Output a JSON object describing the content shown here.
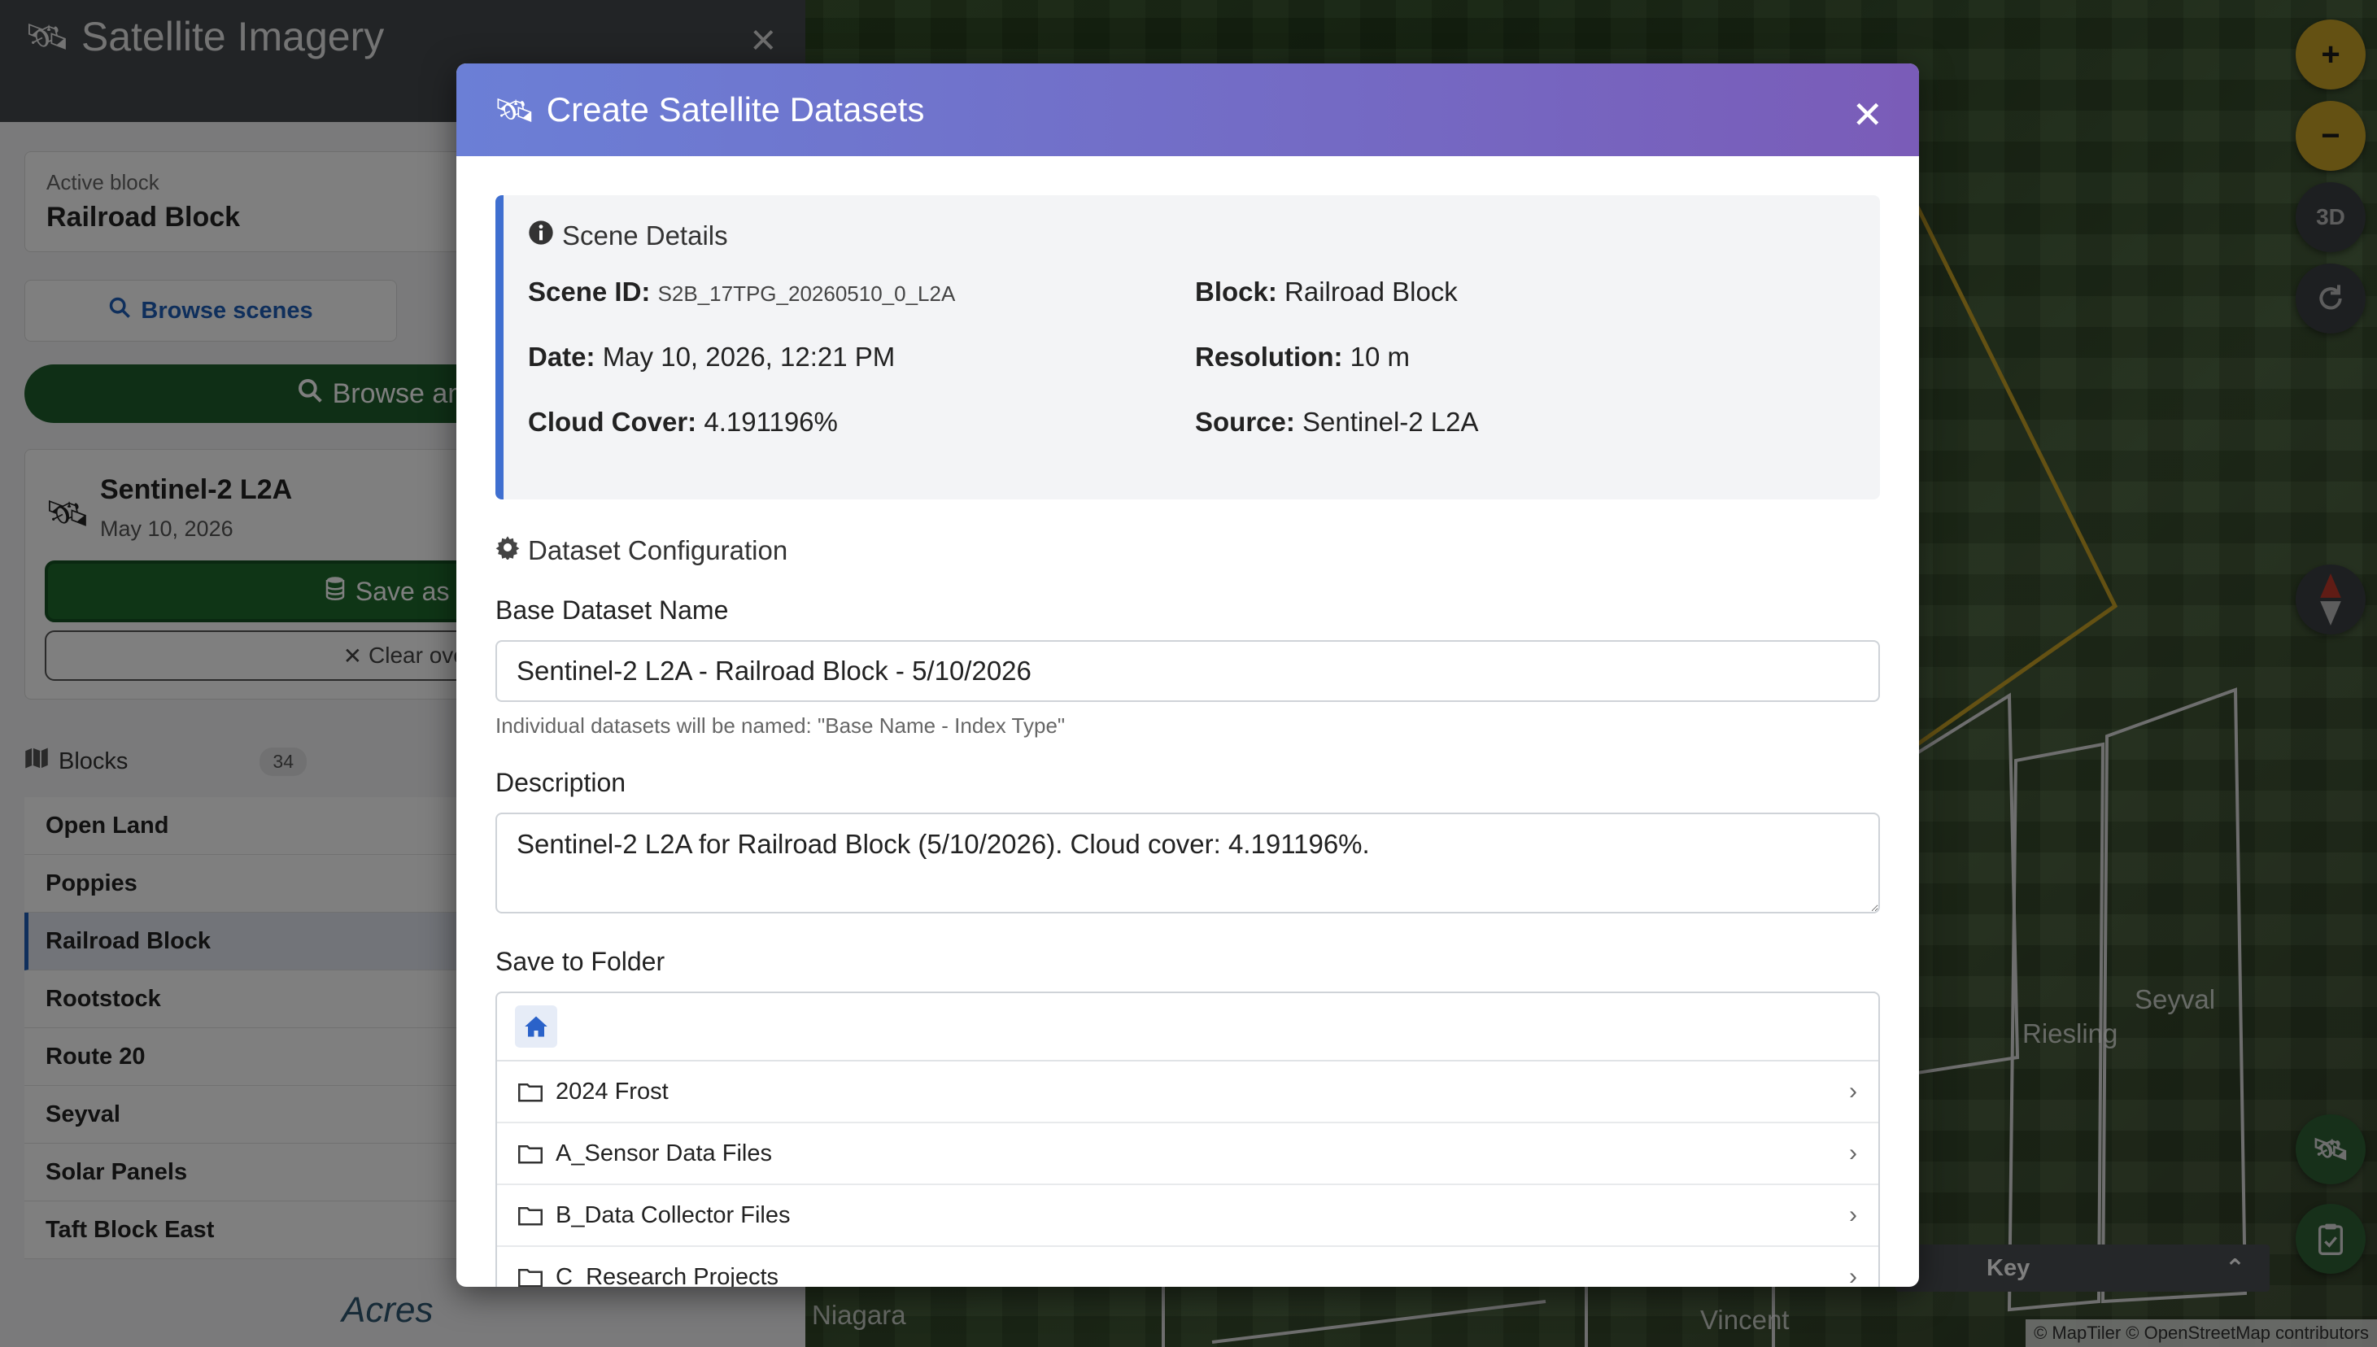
{
  "sidebar": {
    "title": "Satellite Imagery",
    "active_block_label": "Active block",
    "active_block_value": "Railroad Block",
    "browse_scenes_label": "Browse scenes",
    "browse_another_label": "Browse anothe",
    "scene_card": {
      "title": "Sentinel-2 L2A",
      "date": "May 10, 2026",
      "save_label": "Save as Dat",
      "clear_label": "Clear overl"
    },
    "blocks_label": "Blocks",
    "blocks_count": "34",
    "blocks": [
      {
        "label": "Open Land"
      },
      {
        "label": "Poppies"
      },
      {
        "label": "Railroad Block"
      },
      {
        "label": "Rootstock"
      },
      {
        "label": "Route 20"
      },
      {
        "label": "Seyval"
      },
      {
        "label": "Solar Panels"
      },
      {
        "label": "Taft Block East"
      }
    ],
    "footer_logo": "Acres"
  },
  "modal": {
    "title": "Create Satellite Datasets",
    "scene_details_title": "Scene Details",
    "scene": {
      "id_label": "Scene ID:",
      "id_value": "S2B_17TPG_20260510_0_L2A",
      "block_label": "Block:",
      "block_value": "Railroad Block",
      "date_label": "Date:",
      "date_value": "May 10, 2026, 12:21 PM",
      "resolution_label": "Resolution:",
      "resolution_value": "10 m",
      "cloud_label": "Cloud Cover:",
      "cloud_value": "4.191196%",
      "source_label": "Source:",
      "source_value": "Sentinel-2 L2A"
    },
    "config_title": "Dataset Configuration",
    "base_name_label": "Base Dataset Name",
    "base_name_value": "Sentinel-2 L2A - Railroad Block - 5/10/2026",
    "base_name_help": "Individual datasets will be named: \"Base Name - Index Type\"",
    "description_label": "Description",
    "description_value": "Sentinel-2 L2A for Railroad Block (5/10/2026). Cloud cover: 4.191196%.",
    "folder_label": "Save to Folder",
    "folders": [
      {
        "name": "2024 Frost"
      },
      {
        "name": "A_Sensor Data Files"
      },
      {
        "name": "B_Data Collector Files"
      },
      {
        "name": "C_Research Projects"
      }
    ]
  },
  "map": {
    "labels": {
      "riesling": "Riesling",
      "seyval": "Seyval",
      "niagara": "Niagara",
      "vincent": "Vincent"
    },
    "attribution": "© MapTiler © OpenStreetMap contributors",
    "btn_3d": "3D",
    "key_label": "Key"
  },
  "colors": {
    "accent_blue": "#1f5fb8",
    "brand_green": "#1f5e2c",
    "modal_gradient_start": "#6b7fd6",
    "modal_gradient_end": "#7a5cb8",
    "map_gold": "#c9a227"
  }
}
